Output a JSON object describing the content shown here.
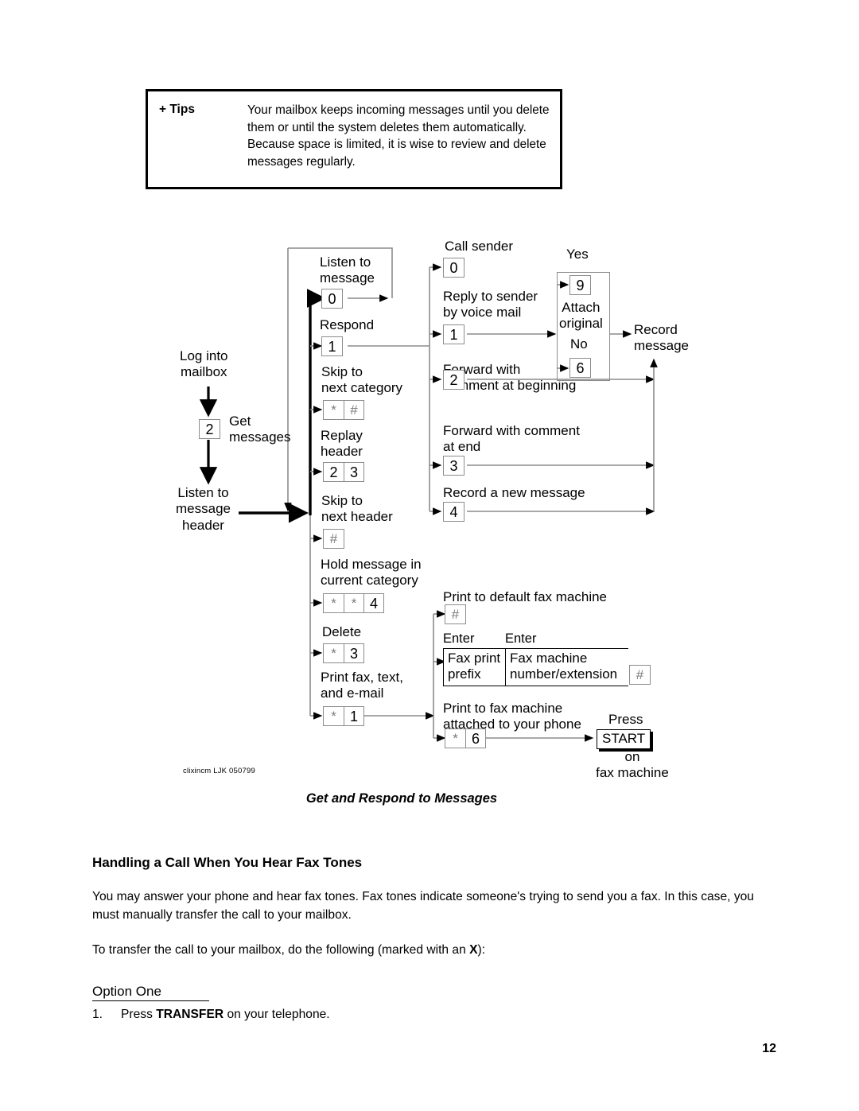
{
  "tips": {
    "label": "+ Tips",
    "text": "Your mailbox keeps incoming messages until you delete them or until the system deletes them automatically.  Because space is limited, it is wise to review and delete messages regularly."
  },
  "flowchart": {
    "caption": "Get and Respond to Messages",
    "credit": "clixincm LJK 050799",
    "labels": {
      "log_into_mailbox": "Log into\nmailbox",
      "get_messages": "Get\nmessages",
      "listen_message_header": "Listen to\nmessage\nheader",
      "listen_to_message": "Listen to\nmessage",
      "respond": "Respond",
      "skip_next_category": "Skip to\nnext category",
      "replay_header": "Replay\nheader",
      "skip_next_header": "Skip to\nnext header",
      "hold_message": "Hold message in\ncurrent category",
      "delete": "Delete",
      "print_fax_text_email": "Print fax, text,\nand e-mail",
      "call_sender": "Call sender",
      "reply_voice_mail": "Reply to sender\nby voice mail",
      "forward_comment_beginning": "Forward with\ncomment at beginning",
      "forward_comment_end": "Forward with comment\nat end",
      "record_new_message": "Record a new message",
      "attach_original": "Attach\noriginal",
      "yes": "Yes",
      "no": "No",
      "record_message": "Record\nmessage",
      "print_default_fax": "Print to default fax machine",
      "enter_1": "Enter",
      "enter_2": "Enter",
      "fax_print_prefix": "Fax print\nprefix",
      "fax_machine_number": "Fax machine\nnumber/extension",
      "print_attached_fax": "Print to fax machine\nattached to your phone",
      "press": "Press",
      "start": "START",
      "on_fax_machine": "on\nfax machine"
    },
    "keys": {
      "get_messages": [
        "2"
      ],
      "listen_to_message": [
        "0"
      ],
      "respond": [
        "1"
      ],
      "skip_next_category": [
        "*",
        "#"
      ],
      "replay_header": [
        "2",
        "3"
      ],
      "skip_next_header": [
        "#"
      ],
      "hold_message": [
        "*",
        "*",
        "4"
      ],
      "delete": [
        "*",
        "3"
      ],
      "print_fax_text_email": [
        "*",
        "1"
      ],
      "call_sender": [
        "0"
      ],
      "reply_voice_mail": [
        "1"
      ],
      "attach_yes": [
        "9"
      ],
      "attach_no": [
        "6"
      ],
      "forward_comment_beginning": [
        "2"
      ],
      "forward_comment_end": [
        "3"
      ],
      "record_new_message": [
        "4"
      ],
      "print_default_fax": [
        "#"
      ],
      "fax_table_end": [
        "#"
      ],
      "print_attached_fax": [
        "*",
        "6"
      ]
    }
  },
  "section": {
    "heading": "Handling a Call When You Hear Fax Tones",
    "para1_a": "You may answer your phone and hear fax tones.  Fax tones indicate someone's trying to send you a fax.  In this case, you must manually transfer the call to your mailbox.",
    "para2_a": "To transfer the call to your mailbox, do the following (marked with an ",
    "para2_bold": "X",
    "para2_b": "):",
    "option_one": "Option One",
    "step1_num": "1.",
    "step1_a": "Press ",
    "step1_bold": "TRANSFER",
    "step1_b": " on your telephone."
  },
  "page_number": "12"
}
